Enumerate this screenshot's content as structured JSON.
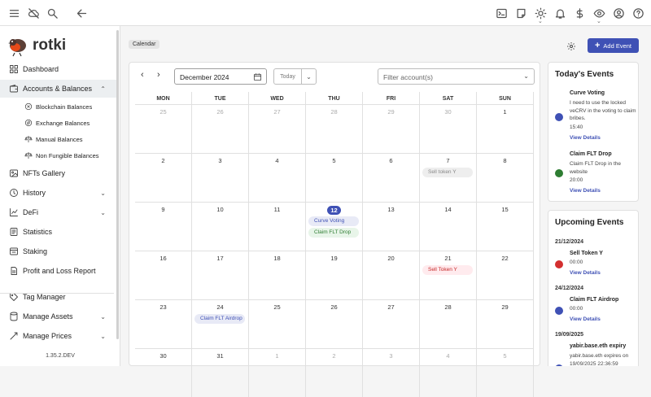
{
  "app": {
    "name": "rotki",
    "version": "1.35.2.DEV"
  },
  "breadcrumb": "Calendar",
  "add_event_label": "Add Event",
  "colors": {
    "accent": "#3f51b5",
    "green": "#2e7d32",
    "red": "#d32f2f"
  },
  "topbar_icons": [
    "menu-icon",
    "cloud-off-icon",
    "search-icon",
    "back-arrow-icon",
    "terminal-icon",
    "notes-icon",
    "theme-icon",
    "bell-icon",
    "dollar-icon",
    "eye-icon",
    "account-icon",
    "help-icon"
  ],
  "sidebar": {
    "items": [
      {
        "label": "Dashboard",
        "icon": "dashboard-icon"
      },
      {
        "label": "Accounts & Balances",
        "icon": "wallet-icon",
        "chevron": "up"
      },
      {
        "label": "Blockchain Balances",
        "icon": "chain-icon",
        "sub": true
      },
      {
        "label": "Exchange Balances",
        "icon": "exchange-icon",
        "sub": true
      },
      {
        "label": "Manual Balances",
        "icon": "scale-icon",
        "sub": true
      },
      {
        "label": "Non Fungible Balances",
        "icon": "scale-icon",
        "sub": true
      },
      {
        "label": "NFTs Gallery",
        "icon": "image-icon"
      },
      {
        "label": "History",
        "icon": "history-icon",
        "chevron": "down"
      },
      {
        "label": "DeFi",
        "icon": "chart-icon",
        "chevron": "down"
      },
      {
        "label": "Statistics",
        "icon": "statistics-icon"
      },
      {
        "label": "Staking",
        "icon": "staking-icon"
      },
      {
        "label": "Profit and Loss Report",
        "icon": "report-icon"
      },
      {
        "label": "Tag Manager",
        "icon": "tag-icon"
      },
      {
        "label": "Manage Assets",
        "icon": "database-icon",
        "chevron": "down"
      },
      {
        "label": "Manage Prices",
        "icon": "prices-icon",
        "chevron": "down"
      }
    ]
  },
  "calendar": {
    "month_label": "December 2024",
    "today_label": "Today",
    "filter_placeholder": "Filter account(s)",
    "weekdays": [
      "MON",
      "TUE",
      "WED",
      "THU",
      "FRI",
      "SAT",
      "SUN"
    ],
    "weeks": [
      [
        {
          "d": "25",
          "dim": true
        },
        {
          "d": "26",
          "dim": true
        },
        {
          "d": "27",
          "dim": true
        },
        {
          "d": "28",
          "dim": true
        },
        {
          "d": "29",
          "dim": true
        },
        {
          "d": "30",
          "dim": true
        },
        {
          "d": "1"
        }
      ],
      [
        {
          "d": "2"
        },
        {
          "d": "3"
        },
        {
          "d": "4"
        },
        {
          "d": "5"
        },
        {
          "d": "6"
        },
        {
          "d": "7",
          "events": [
            {
              "label": "Sell token Y",
              "color": "grey"
            }
          ]
        },
        {
          "d": "8"
        }
      ],
      [
        {
          "d": "9"
        },
        {
          "d": "10"
        },
        {
          "d": "11"
        },
        {
          "d": "12",
          "today": true,
          "events": [
            {
              "label": "Curve Voting",
              "color": "indigo"
            },
            {
              "label": "Claim FLT Drop",
              "color": "green"
            }
          ]
        },
        {
          "d": "13"
        },
        {
          "d": "14"
        },
        {
          "d": "15"
        }
      ],
      [
        {
          "d": "16"
        },
        {
          "d": "17"
        },
        {
          "d": "18"
        },
        {
          "d": "19"
        },
        {
          "d": "20"
        },
        {
          "d": "21",
          "events": [
            {
              "label": "Sell Token Y",
              "color": "red"
            }
          ]
        },
        {
          "d": "22"
        }
      ],
      [
        {
          "d": "23"
        },
        {
          "d": "24",
          "events": [
            {
              "label": "Claim FLT Airdrop",
              "color": "indigo"
            }
          ]
        },
        {
          "d": "25"
        },
        {
          "d": "26"
        },
        {
          "d": "27"
        },
        {
          "d": "28"
        },
        {
          "d": "29"
        }
      ],
      [
        {
          "d": "30"
        },
        {
          "d": "31"
        },
        {
          "d": "1",
          "dim": true
        },
        {
          "d": "2",
          "dim": true
        },
        {
          "d": "3",
          "dim": true
        },
        {
          "d": "4",
          "dim": true
        },
        {
          "d": "5",
          "dim": true
        }
      ]
    ]
  },
  "todays_events": {
    "title": "Today's Events",
    "events": [
      {
        "title": "Curve Voting",
        "desc": "I need to use the locked veCRV in the voting to claim bribes.",
        "time": "15:40",
        "link": "View Details",
        "color": "#3f51b5"
      },
      {
        "title": "Claim FLT Drop",
        "desc": "Claim FLT Drop in the website",
        "time": "20:00",
        "link": "View Details",
        "color": "#2e7d32"
      }
    ]
  },
  "upcoming_events": {
    "title": "Upcoming Events",
    "groups": [
      {
        "date": "21/12/2024",
        "title": "Sell Token Y",
        "time": "00:00",
        "link": "View Details",
        "color": "#d32f2f"
      },
      {
        "date": "24/12/2024",
        "title": "Claim FLT Airdrop",
        "time": "00:00",
        "link": "View Details",
        "color": "#3f51b5"
      },
      {
        "date": "19/09/2025",
        "title": "yabir.base.eth expiry",
        "desc": "yabir.base.eth expires on 19/09/2025 22:36:59",
        "color": "#3f51b5"
      }
    ]
  }
}
